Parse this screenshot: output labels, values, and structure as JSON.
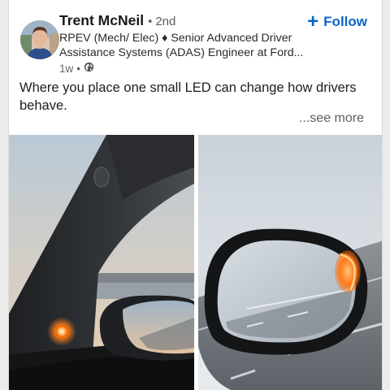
{
  "post": {
    "author": {
      "name": "Trent McNeil",
      "degree": "2nd",
      "headline": "RPEV (Mech/ Elec) ♦ Senior Advanced Driver Assistance Systems (ADAS) Engineer at Ford...",
      "time": "1w",
      "visibility_icon": "globe-icon"
    },
    "follow_label": "Follow",
    "text": "Where you place one small LED can change how drivers behave.",
    "see_more": "...see more",
    "images": [
      {
        "subject": "a-pillar-led-indicator"
      },
      {
        "subject": "side-mirror-blind-spot-indicator"
      }
    ],
    "accent_color": "#0a66c2",
    "led_color": "#ff7a1a"
  }
}
